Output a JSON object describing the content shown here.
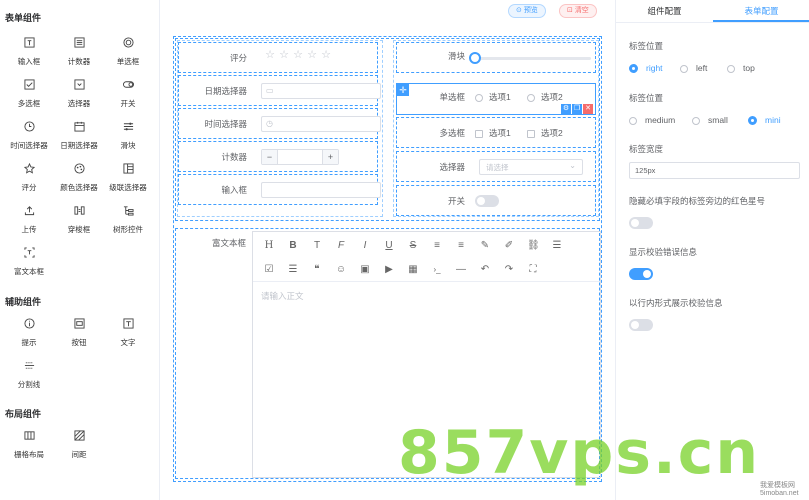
{
  "palette": {
    "form_section_title": "表单组件",
    "form_items": [
      {
        "icon": "input-icon",
        "label": "输入框"
      },
      {
        "icon": "counter-icon",
        "label": "计数器"
      },
      {
        "icon": "radio-icon",
        "label": "单选框"
      },
      {
        "icon": "checkbox-icon",
        "label": "多选框"
      },
      {
        "icon": "select-icon",
        "label": "选择器"
      },
      {
        "icon": "switch-icon",
        "label": "开关"
      },
      {
        "icon": "clock-icon",
        "label": "时间选择器"
      },
      {
        "icon": "calendar-icon",
        "label": "日期选择器"
      },
      {
        "icon": "slider-icon",
        "label": "滑块"
      },
      {
        "icon": "star-icon",
        "label": "评分"
      },
      {
        "icon": "palette-icon",
        "label": "颜色选择器"
      },
      {
        "icon": "cascader-icon",
        "label": "级联选择器"
      },
      {
        "icon": "upload-icon",
        "label": "上传"
      },
      {
        "icon": "transfer-icon",
        "label": "穿梭框"
      },
      {
        "icon": "tree-icon",
        "label": "树形控件"
      },
      {
        "icon": "richtext-icon",
        "label": "富文本框"
      }
    ],
    "aux_section_title": "辅助组件",
    "aux_items": [
      {
        "icon": "info-icon",
        "label": "提示"
      },
      {
        "icon": "button-icon",
        "label": "按钮"
      },
      {
        "icon": "text-icon",
        "label": "文字"
      },
      {
        "icon": "divider-icon",
        "label": "分割线"
      }
    ],
    "layout_section_title": "布局组件",
    "layout_items": [
      {
        "icon": "grid-icon",
        "label": "栅格布局"
      },
      {
        "icon": "spacing-icon",
        "label": "间距"
      }
    ]
  },
  "toolbar": {
    "preview_label": "预览",
    "clear_label": "清空"
  },
  "form_left": {
    "rate_label": "评分",
    "date_label": "日期选择器",
    "time_label": "时间选择器",
    "counter_label": "计数器",
    "counter_minus": "−",
    "counter_plus": "+",
    "input_label": "输入框"
  },
  "form_right": {
    "slider_label": "滑块",
    "slider_value": 0,
    "radio_label": "单选框",
    "radio_options": [
      "选项1",
      "选项2"
    ],
    "checkbox_label": "多选框",
    "checkbox_options": [
      "选项1",
      "选项2"
    ],
    "select_label": "选择器",
    "select_placeholder": "请选择",
    "switch_label": "开关",
    "switch_on": false
  },
  "richtext": {
    "label": "富文本框",
    "placeholder": "请输入正文",
    "toolbar_row1": [
      "H",
      "B",
      "T",
      "F",
      "I",
      "U",
      "S",
      "≡",
      "≡",
      "✎",
      "✐",
      "⛓",
      "☰"
    ],
    "toolbar_row2": [
      "☑",
      "☰",
      "❝",
      "☺",
      "▣",
      "▶",
      "▦",
      "›_",
      "—",
      "↶",
      "↷",
      "⛶"
    ]
  },
  "right_panel": {
    "tabs": [
      "组件配置",
      "表单配置"
    ],
    "active_tab": 1,
    "label_position_title": "标签位置",
    "label_position_options": [
      "right",
      "left",
      "top"
    ],
    "label_position_selected": 0,
    "label_size_title": "标签位置",
    "label_size_options": [
      "medium",
      "small",
      "mini"
    ],
    "label_size_selected": 2,
    "label_width_title": "标签宽度",
    "label_width_value": "125px",
    "hide_required_title": "隐藏必填字段的标签旁边的红色星号",
    "hide_required_on": false,
    "show_validation_title": "显示校验错误信息",
    "show_validation_on": true,
    "inline_validation_title": "以行内形式展示校验信息",
    "inline_validation_on": false
  },
  "watermark": {
    "big": "857vps.cn",
    "small1": "我爱模板网",
    "small2": "5imoban.net"
  },
  "colors": {
    "accent": "#409eff",
    "danger": "#f56c6c",
    "watermark": "#78d228"
  }
}
